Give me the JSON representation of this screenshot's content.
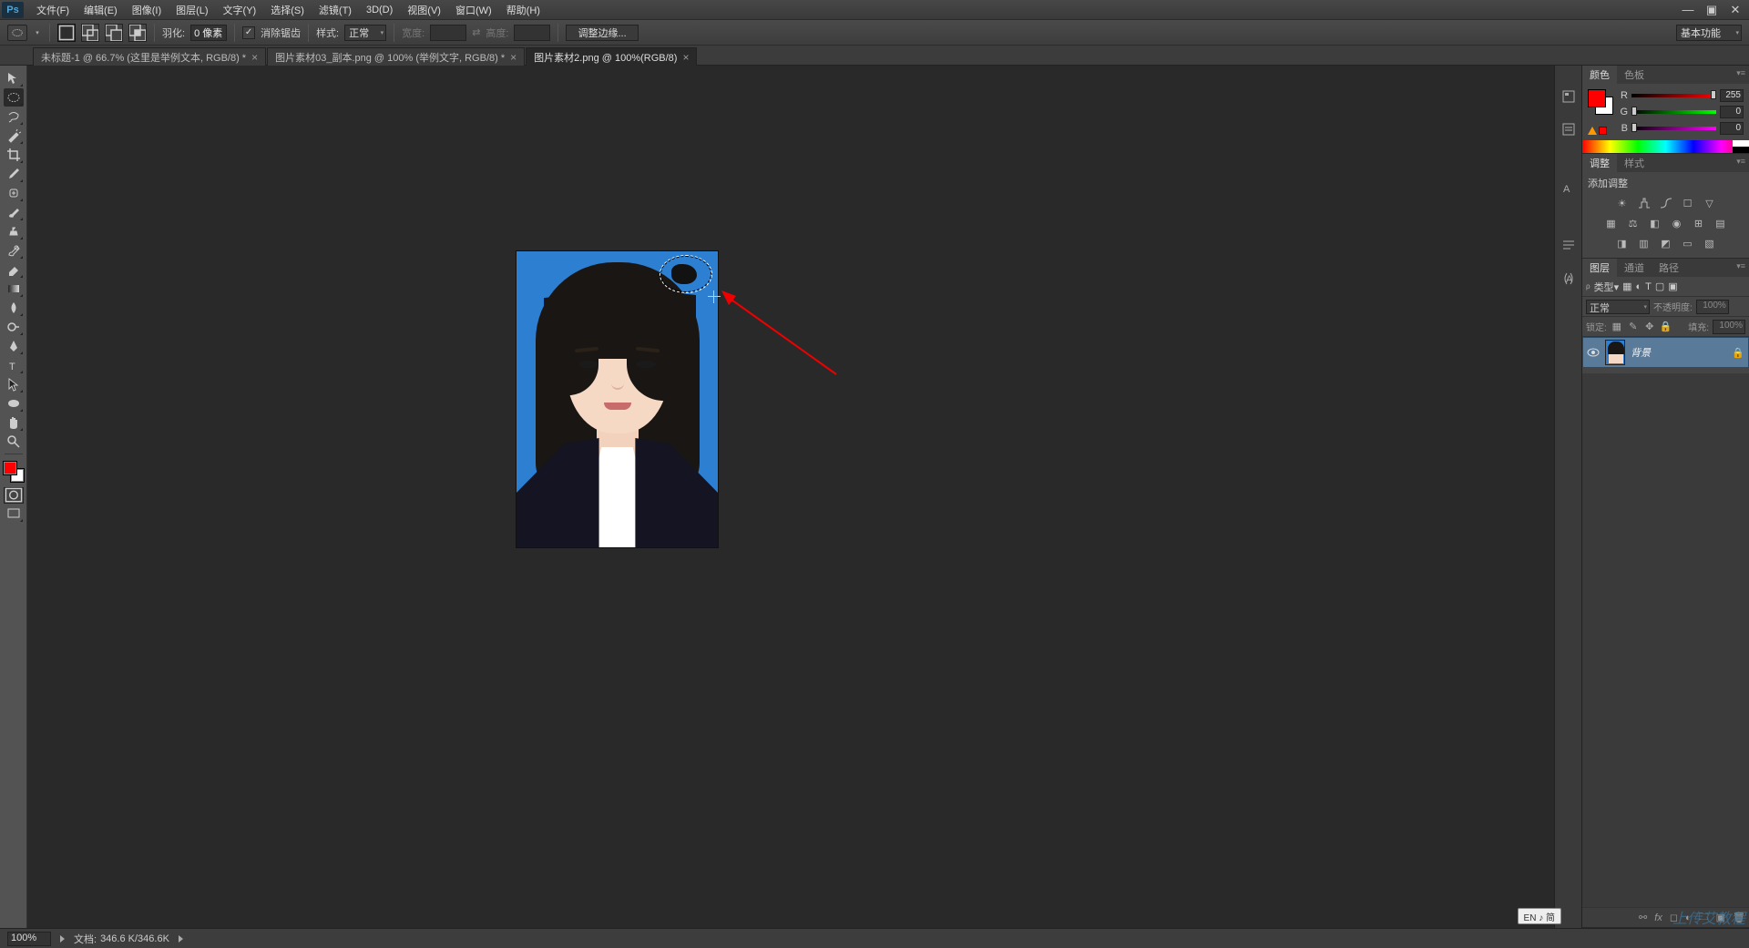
{
  "menubar": {
    "logo": "Ps",
    "items": [
      "文件(F)",
      "编辑(E)",
      "图像(I)",
      "图层(L)",
      "文字(Y)",
      "选择(S)",
      "滤镜(T)",
      "3D(D)",
      "视图(V)",
      "窗口(W)",
      "帮助(H)"
    ]
  },
  "optionbar": {
    "feather_label": "羽化:",
    "feather_value": "0 像素",
    "antialias_label": "消除锯齿",
    "style_label": "样式:",
    "style_value": "正常",
    "width_label": "宽度:",
    "height_label": "高度:",
    "refine_edge": "调整边缘...",
    "workspace": "基本功能"
  },
  "tabs": [
    {
      "title": "未标题-1 @ 66.7% (这里是举例文本, RGB/8) *"
    },
    {
      "title": "图片素材03_副本.png @ 100% (举例文字, RGB/8) *"
    },
    {
      "title": "图片素材2.png @ 100%(RGB/8)"
    }
  ],
  "panels": {
    "color": {
      "tab1": "颜色",
      "tab2": "色板",
      "r_label": "R",
      "g_label": "G",
      "b_label": "B",
      "r_value": "255",
      "g_value": "0",
      "b_value": "0"
    },
    "adjust": {
      "tab1": "调整",
      "tab2": "样式",
      "add_label": "添加调整"
    },
    "layers": {
      "tab1": "图层",
      "tab2": "通道",
      "tab3": "路径",
      "kind_label": "类型",
      "blend_mode": "正常",
      "opacity_label": "不透明度:",
      "opacity_value": "100%",
      "lock_label": "锁定:",
      "fill_label": "填充:",
      "fill_value": "100%",
      "layer_name": "背景"
    }
  },
  "statusbar": {
    "zoom": "100%",
    "doc_label": "文档:",
    "doc_size": "346.6 K/346.6K"
  },
  "ime": "EN ♪ 简",
  "watermark": "上传艾教程"
}
